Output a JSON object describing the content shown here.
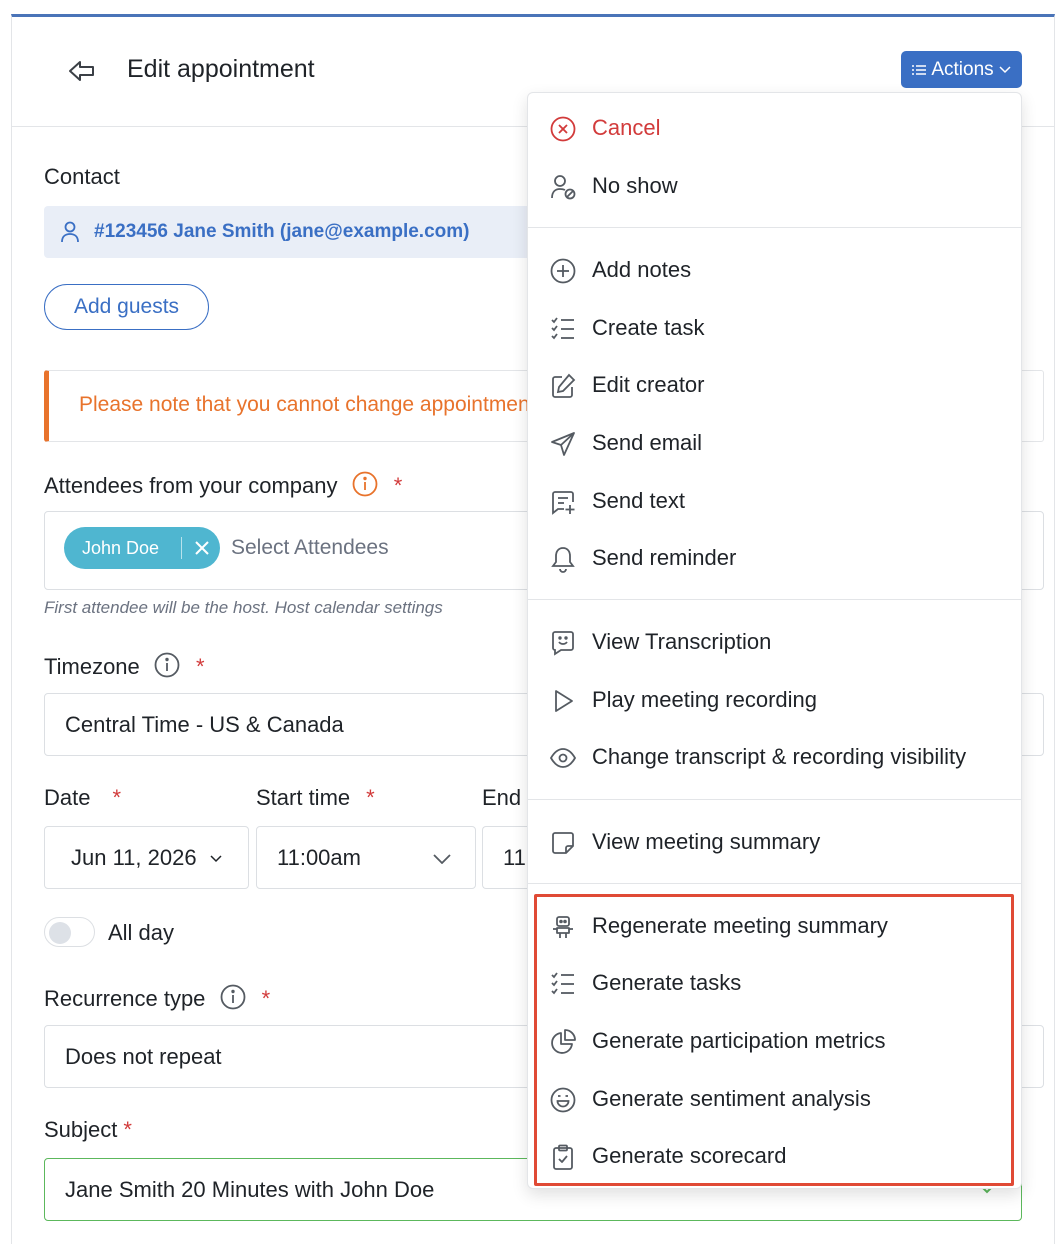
{
  "header": {
    "title": "Edit appointment",
    "actions_label": "Actions"
  },
  "contact": {
    "label": "Contact",
    "value": "#123456 Jane Smith (jane@example.com)",
    "add_guests": "Add guests"
  },
  "note": "Please note that you cannot change appointment",
  "attendees": {
    "label": "Attendees from your company",
    "selected": [
      "John Doe"
    ],
    "placeholder": "Select Attendees",
    "hint": "First attendee will be the host. Host calendar settings"
  },
  "timezone": {
    "label": "Timezone",
    "value": "Central Time - US & Canada"
  },
  "date": {
    "label": "Date",
    "value": "Jun 11, 2026"
  },
  "start_time": {
    "label": "Start time",
    "value": "11:00am"
  },
  "end_time": {
    "label": "End",
    "value": "11:"
  },
  "all_day": {
    "label": "All day",
    "checked": false
  },
  "recurrence": {
    "label": "Recurrence type",
    "value": "Does not repeat"
  },
  "subject": {
    "label": "Subject",
    "value": "Jane Smith 20 Minutes with John Doe"
  },
  "required_marker": "*",
  "menu": {
    "groups": [
      [
        {
          "label": "Cancel",
          "icon": "cancel-circle-icon",
          "danger": true
        },
        {
          "label": "No show",
          "icon": "user-no-show-icon"
        }
      ],
      [
        {
          "label": "Add notes",
          "icon": "plus-circle-icon"
        },
        {
          "label": "Create task",
          "icon": "checklist-icon"
        },
        {
          "label": "Edit creator",
          "icon": "edit-icon"
        },
        {
          "label": "Send email",
          "icon": "send-icon"
        },
        {
          "label": "Send text",
          "icon": "message-plus-icon"
        },
        {
          "label": "Send reminder",
          "icon": "bell-icon"
        }
      ],
      [
        {
          "label": "View Transcription",
          "icon": "transcription-icon"
        },
        {
          "label": "Play meeting recording",
          "icon": "play-icon"
        },
        {
          "label": "Change transcript & recording visibility",
          "icon": "eye-icon"
        }
      ],
      [
        {
          "label": "View meeting summary",
          "icon": "note-icon"
        }
      ],
      [
        {
          "label": "Regenerate meeting summary",
          "icon": "robot-icon"
        },
        {
          "label": "Generate tasks",
          "icon": "checklist-icon"
        },
        {
          "label": "Generate participation metrics",
          "icon": "pie-chart-icon"
        },
        {
          "label": "Generate sentiment analysis",
          "icon": "smile-icon"
        },
        {
          "label": "Generate scorecard",
          "icon": "clipboard-check-icon"
        }
      ]
    ]
  },
  "colors": {
    "accent": "#3a6fc4",
    "danger": "#d23b3b",
    "warning": "#e8732c",
    "highlight_box": "#e04a35",
    "attendee_pill": "#4fb6d0"
  }
}
